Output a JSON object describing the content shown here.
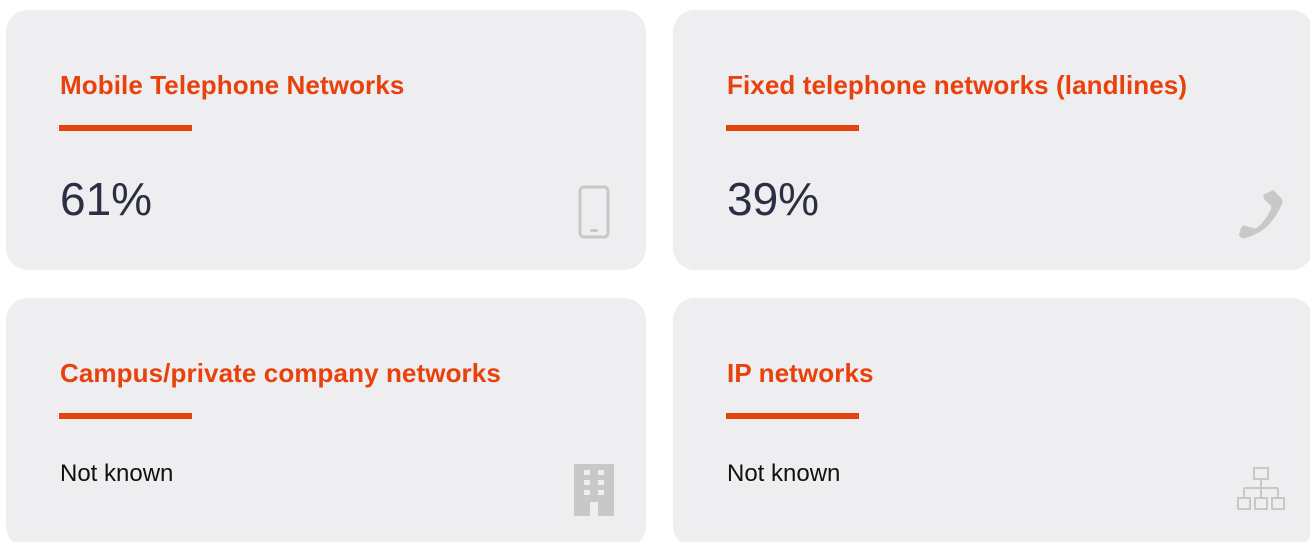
{
  "cards": [
    {
      "title": "Mobile Telephone Networks",
      "value": "61%",
      "icon": "mobile-phone-icon"
    },
    {
      "title": "Fixed telephone networks (landlines)",
      "value": "39%",
      "icon": "telephone-handset-icon"
    },
    {
      "title": "Campus/private company networks",
      "value": "Not known",
      "icon": "building-icon"
    },
    {
      "title": "IP networks",
      "value": "Not known",
      "icon": "network-hierarchy-icon"
    }
  ],
  "colors": {
    "accent": "#e8410b",
    "card_background": "#eeedef",
    "value_text": "#2c2f44",
    "icon": "#c8c8c8"
  }
}
